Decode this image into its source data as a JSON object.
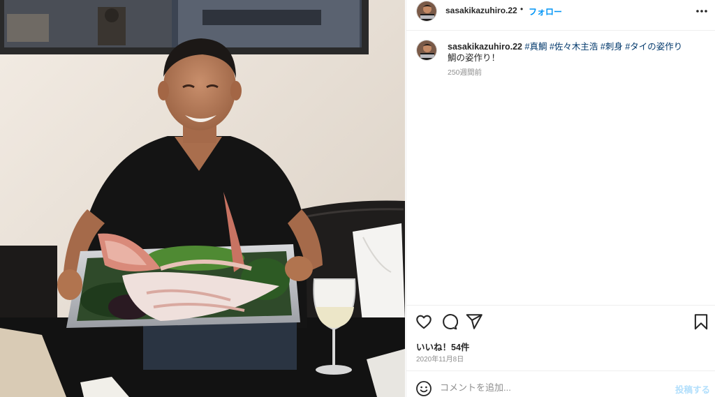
{
  "post": {
    "username": "sasakikazuhiro.22",
    "separator": "•",
    "follow_label": "フォロー",
    "more_icon": "more-horizontal-icon"
  },
  "caption": {
    "username": "sasakikazuhiro.22",
    "hashtags": [
      "#真鯛",
      "#佐々木主浩",
      "#刺身",
      "#タイの姿作り"
    ],
    "body": "鯛の姿作り！",
    "time_ago": "250週間前"
  },
  "actions": {
    "like_icon": "heart-icon",
    "comment_icon": "comment-icon",
    "share_icon": "paper-plane-icon",
    "save_icon": "bookmark-icon"
  },
  "likes_text": "いいね！54件",
  "date": "2020年11月8日",
  "comment_box": {
    "emoji_icon": "smiley-icon",
    "placeholder": "コメントを追加...",
    "post_label": "投稿する"
  },
  "colors": {
    "link": "#0095f6",
    "hashtag": "#00376b",
    "muted": "#8e8e8e",
    "post_disabled": "#b2dffc",
    "text": "#262626"
  }
}
